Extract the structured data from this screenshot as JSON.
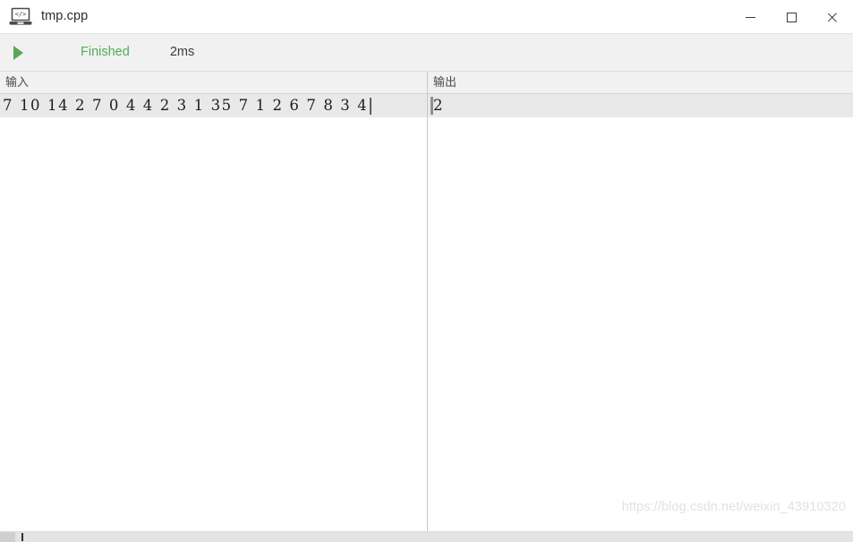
{
  "window": {
    "title": "tmp.cpp",
    "icon": "laptop-code-icon",
    "controls": {
      "minimize": "minimize",
      "maximize": "maximize",
      "close": "close"
    }
  },
  "toolbar": {
    "run_icon": "play-icon",
    "status_label": "Finished",
    "elapsed_label": "2ms",
    "status_color": "#51ad57",
    "run_icon_color": "#58a85b"
  },
  "panes": {
    "input": {
      "header": "输入",
      "content": "7 10 14 2 7 0 4 4 2 3 1 35 7 1 2 6 7 8 3 4",
      "caret_visible": true
    },
    "output": {
      "header": "输出",
      "content": "2",
      "caret_visible": true
    }
  },
  "watermark": {
    "text": "https://blog.csdn.net/weixin_43910320"
  },
  "scrollbar": {
    "orientation": "horizontal",
    "thumb_label": "horizontal-scroll-thumb"
  }
}
